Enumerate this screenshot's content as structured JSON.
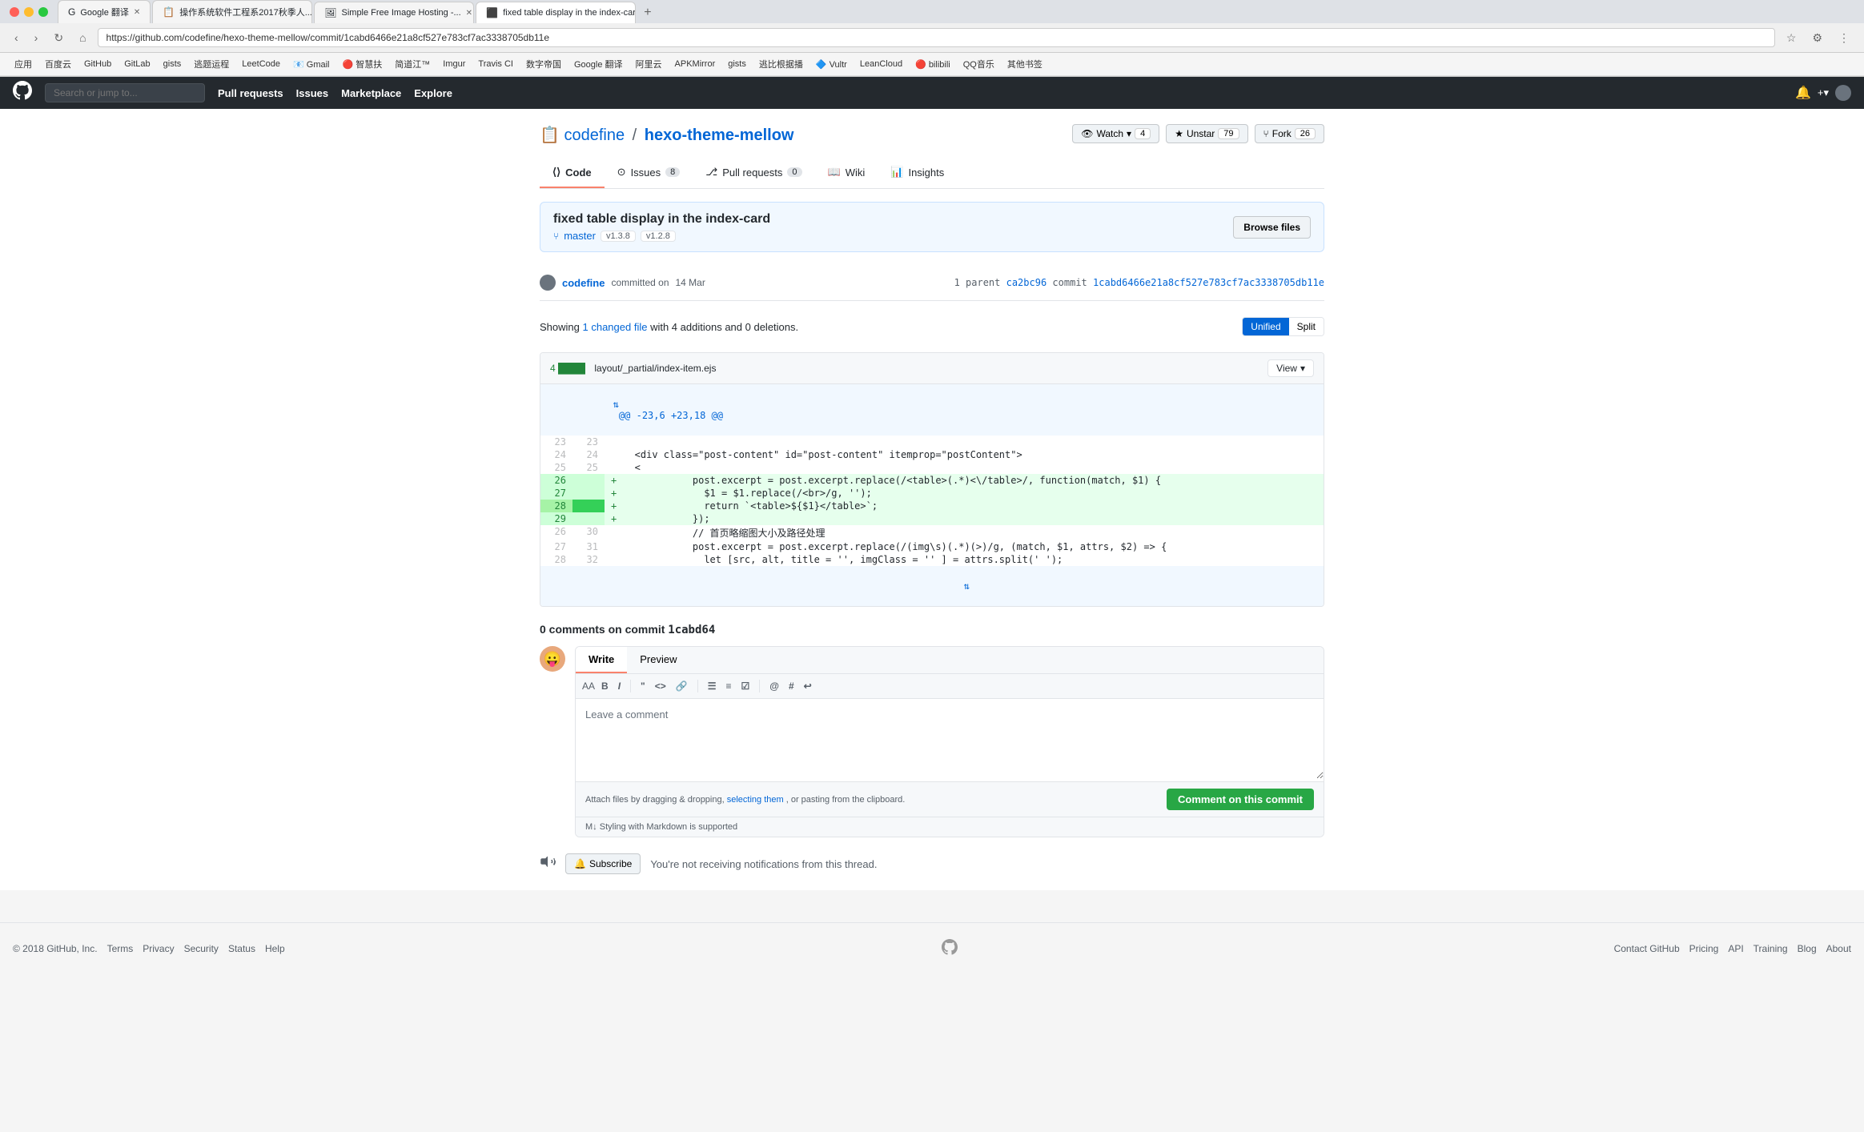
{
  "browser": {
    "tabs": [
      {
        "label": "Google 翻译",
        "active": false,
        "favicon": "G"
      },
      {
        "label": "操作系统软件工程系2017秋季人...",
        "active": false,
        "favicon": "📋"
      },
      {
        "label": "Simple Free Image Hosting -...",
        "active": false,
        "favicon": "🖼"
      },
      {
        "label": "fixed table display in the index...",
        "active": true,
        "favicon": "⬛"
      }
    ],
    "address": "https://github.com/codefine/hexo-theme-mellow/commit/1cabd6466e21a8cf527e783cf7ac3338705db11e"
  },
  "github": {
    "nav": {
      "search_placeholder": "Search or jump to...",
      "links": [
        "Pull requests",
        "Issues",
        "Marketplace",
        "Explore"
      ]
    },
    "repo": {
      "owner": "codefine",
      "name": "hexo-theme-mellow",
      "watch_label": "Watch",
      "watch_count": "4",
      "star_label": "Unstar",
      "star_count": "79",
      "fork_label": "Fork",
      "fork_count": "26"
    },
    "tabs": [
      {
        "label": "Code",
        "icon": "◧",
        "count": null,
        "active": true
      },
      {
        "label": "Issues",
        "icon": "⊙",
        "count": "8",
        "active": false
      },
      {
        "label": "Pull requests",
        "icon": "⎇",
        "count": "0",
        "active": false
      },
      {
        "label": "Wiki",
        "icon": "📖",
        "count": null,
        "active": false
      },
      {
        "label": "Insights",
        "icon": "📊",
        "count": null,
        "active": false
      }
    ],
    "commit": {
      "title": "fixed table display in the index-card",
      "branch": "master",
      "tag1": "v1.3.8",
      "tag2": "v1.2.8",
      "browse_files_label": "Browse files",
      "author": "codefine",
      "action": "committed on",
      "date": "14 Mar",
      "parent_label": "1 parent",
      "parent_sha": "ca2bc96",
      "commit_label": "commit",
      "commit_sha": "1cabd6466e21a8cf527e783cf7ac3338705db11e"
    },
    "diff": {
      "showing_text": "Showing",
      "changed_files": "1 changed file",
      "additions_text": "with 4 additions",
      "deletions_text": "and 0 deletions.",
      "unified_label": "Unified",
      "split_label": "Split"
    },
    "file": {
      "additions": "4 ████",
      "path": "layout/_partial/index-item.ejs",
      "view_label": "View",
      "expand_label": "@@ -23,6 +23,18 @@"
    },
    "code_lines": [
      {
        "old_num": "",
        "new_num": "",
        "sign": "",
        "content": "@@ -23,6 +23,18 @@",
        "type": "expand"
      },
      {
        "old_num": "23",
        "new_num": "23",
        "sign": "",
        "content": "",
        "type": "context"
      },
      {
        "old_num": "24",
        "new_num": "24",
        "sign": "",
        "content": "        <div class=\"post-content\" id=\"post-content\" itemprop=\"postContent\">",
        "type": "context"
      },
      {
        "old_num": "25",
        "new_num": "25",
        "sign": "",
        "content": "          <",
        "type": "context"
      },
      {
        "old_num": "26",
        "new_num": "",
        "sign": "+",
        "content": "          post.excerpt = post.excerpt.replace(/<table>(.*)<\\/table>/, function(match, $1) {",
        "type": "add"
      },
      {
        "old_num": "27",
        "new_num": "",
        "sign": "+",
        "content": "            $1 = $1.replace(/<br>/g, '');",
        "type": "add"
      },
      {
        "old_num": "28",
        "new_num": "",
        "sign": "+",
        "content": "            return `<table>${$1}</table>`;",
        "type": "add_strong"
      },
      {
        "old_num": "29",
        "new_num": "",
        "sign": "+",
        "content": "          });",
        "type": "add"
      },
      {
        "old_num": "26",
        "new_num": "30",
        "sign": "",
        "content": "          // 首页略缩图大小及路径处理",
        "type": "context"
      },
      {
        "old_num": "27",
        "new_num": "31",
        "sign": "",
        "content": "          post.excerpt = post.excerpt.replace(/(img\\s)(.*)(\\>)/g, (match, $1, attrs, $2) => {",
        "type": "context"
      },
      {
        "old_num": "28",
        "new_num": "32",
        "sign": "",
        "content": "            let [src, alt, title = '', imgClass = '' ] = attrs.split(' ');",
        "type": "context"
      }
    ],
    "comments": {
      "title": "0 comments on commit",
      "commit_short": "1cabd64",
      "write_tab": "Write",
      "preview_tab": "Preview",
      "textarea_placeholder": "Leave a comment",
      "attach_text": "Attach files by dragging & dropping,",
      "selecting_link": "selecting them",
      "attach_text2": ", or pasting from the clipboard.",
      "markdown_text": "Styling with Markdown is supported",
      "submit_label": "Comment on this commit"
    },
    "subscribe": {
      "btn_label": "Subscribe",
      "text": "You're not receiving notifications from this thread."
    },
    "footer": {
      "copyright": "© 2018 GitHub, Inc.",
      "links": [
        "Terms",
        "Privacy",
        "Security",
        "Status",
        "Help"
      ],
      "right_links": [
        "Contact GitHub",
        "Pricing",
        "API",
        "Training",
        "Blog",
        "About"
      ]
    }
  }
}
